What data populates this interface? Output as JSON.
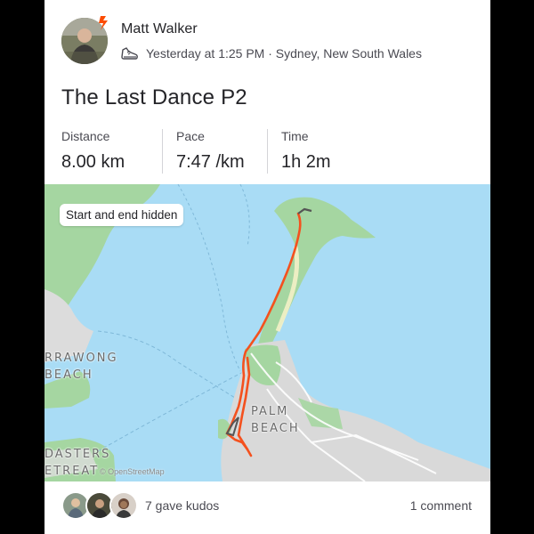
{
  "athlete": {
    "name": "Matt Walker",
    "timestamp_location": "Yesterday at 1:25 PM · Sydney, New South Wales",
    "activity_icon": "running-shoe-icon"
  },
  "activity": {
    "title": "The Last Dance P2"
  },
  "stats": [
    {
      "label": "Distance",
      "value": "8.00 km"
    },
    {
      "label": "Pace",
      "value": "7:47 /km"
    },
    {
      "label": "Time",
      "value": "1h 2m"
    }
  ],
  "map": {
    "privacy_pill": "Start and end hidden",
    "labels": {
      "barrawong": "RRAWONG\nBEACH",
      "palm": "PALM\nBEACH",
      "coasters": "DASTERS\nETREAT"
    },
    "attribution": "© OpenStreetMap",
    "colors": {
      "water": "#a9dcf5",
      "land": "#a5d6a1",
      "route": "#f4511e"
    }
  },
  "footer": {
    "kudos": "7 gave kudos",
    "comments": "1 comment"
  },
  "colors": {
    "brand": "#fc4c02"
  }
}
